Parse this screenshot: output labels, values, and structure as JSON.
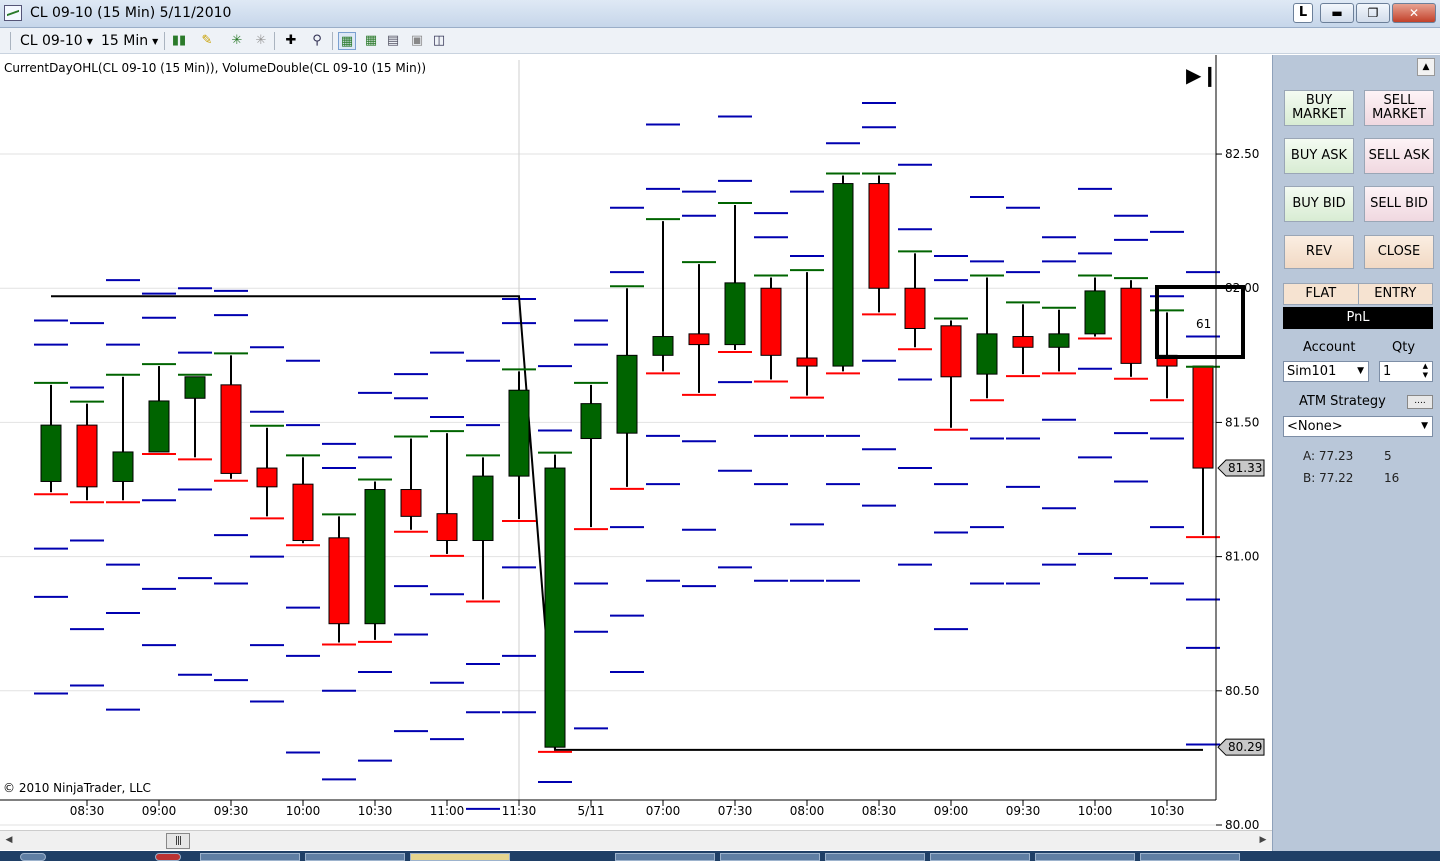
{
  "window": {
    "title": "CL 09-10 (15 Min)  5/11/2010",
    "link_button": "L"
  },
  "toolbar": {
    "instrument": "CL 09-10",
    "interval": "15 Min"
  },
  "chart": {
    "indicator_label": "CurrentDayOHL(CL 09-10 (15 Min)), VolumeDouble(CL 09-10 (15 Min))",
    "copyright": "© 2010 NinjaTrader, LLC",
    "position_box_label": "61",
    "colors": {
      "up": "#006400",
      "down": "#ff0000",
      "volume_level": "#0000b0",
      "high_tick": "#006400",
      "low_tick": "#ff0000",
      "ohl_line": "#000000"
    }
  },
  "chart_data": {
    "type": "candlestick",
    "y_ticks": [
      "82.50",
      "82.00",
      "81.50",
      "81.00",
      "80.50",
      "80.00"
    ],
    "ylim": [
      80.0,
      82.72
    ],
    "x_tick_labels": [
      "08:30",
      "09:00",
      "09:30",
      "10:00",
      "10:30",
      "11:00",
      "11:30",
      "5/11",
      "07:00",
      "07:30",
      "08:00",
      "08:30",
      "09:00",
      "09:30",
      "10:00",
      "10:30"
    ],
    "price_markers": [
      "81.33",
      "80.29"
    ],
    "session_break_index": 14,
    "candles": [
      {
        "o": 81.28,
        "h": 81.64,
        "l": 81.24,
        "c": 81.49
      },
      {
        "o": 81.49,
        "h": 81.57,
        "l": 81.21,
        "c": 81.26
      },
      {
        "o": 81.28,
        "h": 81.67,
        "l": 81.21,
        "c": 81.39
      },
      {
        "o": 81.39,
        "h": 81.71,
        "l": 81.39,
        "c": 81.58
      },
      {
        "o": 81.59,
        "h": 81.67,
        "l": 81.37,
        "c": 81.67
      },
      {
        "o": 81.64,
        "h": 81.75,
        "l": 81.29,
        "c": 81.31
      },
      {
        "o": 81.33,
        "h": 81.48,
        "l": 81.15,
        "c": 81.26
      },
      {
        "o": 81.27,
        "h": 81.37,
        "l": 81.05,
        "c": 81.06
      },
      {
        "o": 81.07,
        "h": 81.15,
        "l": 80.68,
        "c": 80.75
      },
      {
        "o": 80.75,
        "h": 81.28,
        "l": 80.69,
        "c": 81.25
      },
      {
        "o": 81.25,
        "h": 81.44,
        "l": 81.1,
        "c": 81.15
      },
      {
        "o": 81.16,
        "h": 81.46,
        "l": 81.01,
        "c": 81.06
      },
      {
        "o": 81.06,
        "h": 81.37,
        "l": 80.84,
        "c": 81.3
      },
      {
        "o": 81.3,
        "h": 81.69,
        "l": 81.14,
        "c": 81.62
      },
      {
        "o": 80.29,
        "h": 81.38,
        "l": 80.28,
        "c": 81.33
      },
      {
        "o": 81.44,
        "h": 81.64,
        "l": 81.11,
        "c": 81.57
      },
      {
        "o": 81.46,
        "h": 82.0,
        "l": 81.26,
        "c": 81.75
      },
      {
        "o": 81.75,
        "h": 82.25,
        "l": 81.69,
        "c": 81.82
      },
      {
        "o": 81.83,
        "h": 82.09,
        "l": 81.61,
        "c": 81.79
      },
      {
        "o": 81.79,
        "h": 82.31,
        "l": 81.77,
        "c": 82.02
      },
      {
        "o": 82.0,
        "h": 82.04,
        "l": 81.66,
        "c": 81.75
      },
      {
        "o": 81.74,
        "h": 82.06,
        "l": 81.6,
        "c": 81.71
      },
      {
        "o": 81.71,
        "h": 82.42,
        "l": 81.69,
        "c": 82.39
      },
      {
        "o": 82.39,
        "h": 82.42,
        "l": 81.91,
        "c": 82.0
      },
      {
        "o": 82.0,
        "h": 82.13,
        "l": 81.78,
        "c": 81.85
      },
      {
        "o": 81.86,
        "h": 81.88,
        "l": 81.48,
        "c": 81.67
      },
      {
        "o": 81.68,
        "h": 82.04,
        "l": 81.59,
        "c": 81.83
      },
      {
        "o": 81.82,
        "h": 81.94,
        "l": 81.68,
        "c": 81.78
      },
      {
        "o": 81.78,
        "h": 81.92,
        "l": 81.69,
        "c": 81.83
      },
      {
        "o": 81.83,
        "h": 82.04,
        "l": 81.82,
        "c": 81.99
      },
      {
        "o": 82.0,
        "h": 82.03,
        "l": 81.67,
        "c": 81.72
      },
      {
        "o": 81.75,
        "h": 81.91,
        "l": 81.59,
        "c": 81.71
      },
      {
        "o": 81.71,
        "h": 81.7,
        "l": 81.08,
        "c": 81.33
      }
    ]
  },
  "panel": {
    "buttons": {
      "buy_market": "BUY MARKET",
      "sell_market": "SELL MARKET",
      "buy_ask": "BUY ASK",
      "sell_ask": "SELL ASK",
      "buy_bid": "BUY BID",
      "sell_bid": "SELL BID",
      "rev": "REV",
      "close": "CLOSE"
    },
    "flat": "FLAT",
    "entry": "ENTRY",
    "pnl": "PnL",
    "account_label": "Account",
    "qty_label": "Qty",
    "account_value": "Sim101",
    "qty_value": "1",
    "atm_label": "ATM Strategy",
    "atm_value": "<None>",
    "ask_price": "A: 77.23",
    "ask_size": "5",
    "bid_price": "B: 77.22",
    "bid_size": "16"
  }
}
